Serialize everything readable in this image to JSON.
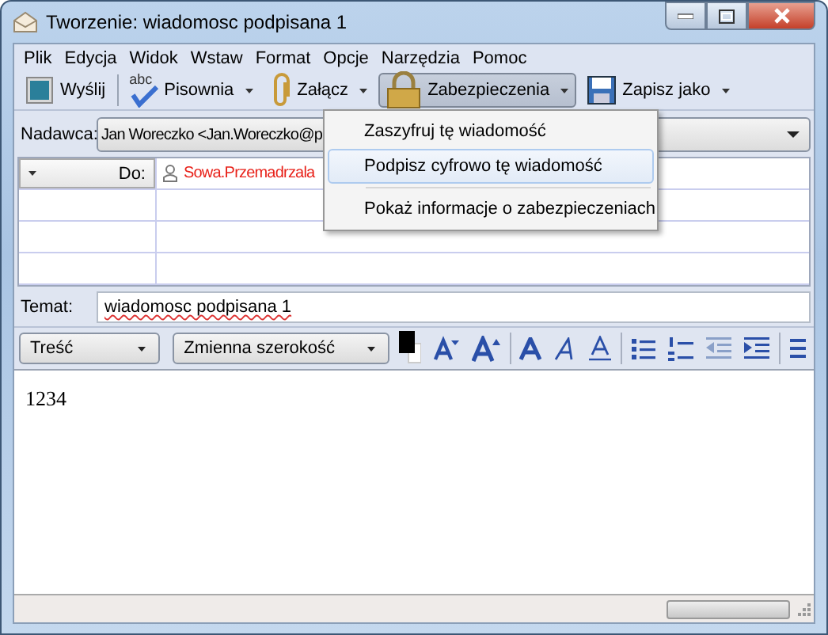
{
  "window": {
    "title": "Tworzenie: wiadomosc podpisana 1"
  },
  "menu": [
    "Plik",
    "Edycja",
    "Widok",
    "Wstaw",
    "Format",
    "Opcje",
    "Narzędzia",
    "Pomoc"
  ],
  "toolbar": [
    {
      "kind": "send",
      "label": "Wyślij",
      "dropdown": false,
      "pressed": false
    },
    {
      "kind": "spell",
      "icon_text": "abc",
      "label": "Pisownia",
      "dropdown": true,
      "pressed": false
    },
    {
      "kind": "attach",
      "label": "Załącz",
      "dropdown": true,
      "pressed": false
    },
    {
      "kind": "security",
      "label": "Zabezpieczenia",
      "dropdown": true,
      "pressed": true
    },
    {
      "kind": "save",
      "label": "Zapisz jako",
      "dropdown": true,
      "pressed": false
    }
  ],
  "security_menu": [
    {
      "kind": "item",
      "label": "Zaszyfruj tę wiadomość",
      "selected": false
    },
    {
      "kind": "item",
      "label": "Podpisz cyfrowo tę wiadomość",
      "selected": true
    },
    {
      "kind": "separator"
    },
    {
      "kind": "item",
      "label": "Pokaż informacje o zabezpieczeniach",
      "selected": false
    }
  ],
  "sender": {
    "label": "Nadawca:",
    "value": "Jan Woreczko <Jan.Woreczko@p"
  },
  "recipients": [
    {
      "type": "Do:",
      "address": "Sowa.Przemadrzala"
    }
  ],
  "subject": {
    "label": "Temat:",
    "value": "wiadomosc podpisana 1"
  },
  "format_bar": {
    "paragraph": "Treść",
    "font": "Zmienna szerokość"
  },
  "body": "1234",
  "status_bar": {
    "progress": {
      "level": 0
    }
  }
}
